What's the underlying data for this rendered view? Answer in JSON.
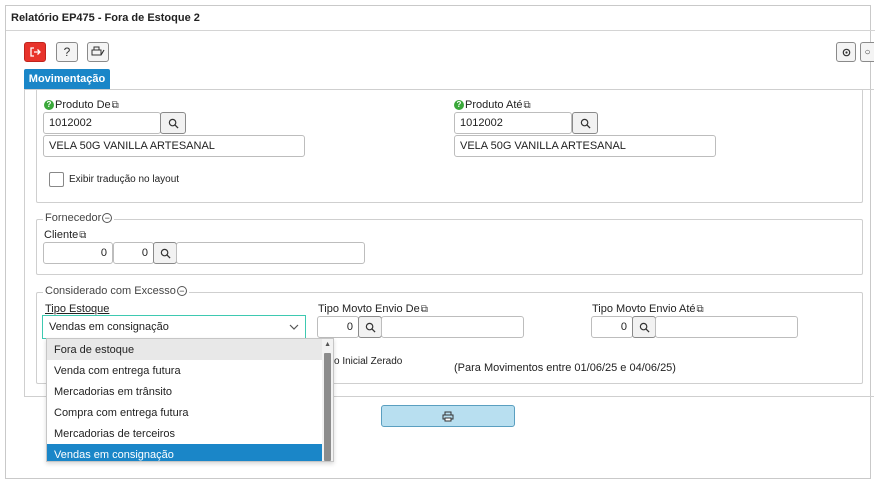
{
  "window": {
    "title": "Relatório EP475 - Fora de Estoque 2"
  },
  "toolbar": {
    "exit_icon": "exit-icon",
    "help_label": "?",
    "print_setup_icon": "print-setup-icon",
    "settings_icon": "gear-icon"
  },
  "tabs": [
    {
      "label": "Movimentação"
    }
  ],
  "produto_de": {
    "label": "Produto De",
    "code": "1012002",
    "description": "VELA 50G VANILLA ARTESANAL"
  },
  "produto_ate": {
    "label": "Produto Até",
    "code": "1012002",
    "description": "VELA 50G VANILLA ARTESANAL"
  },
  "exibir_traducao": {
    "label": "Exibir tradução no layout",
    "checked": false
  },
  "fornecedor": {
    "legend": "Fornecedor",
    "cliente_label": "Cliente",
    "value1": "0",
    "value2": "0",
    "name": ""
  },
  "considerado": {
    "legend": "Considerado com Excesso",
    "tipo_estoque_label": "Tipo Estoque",
    "tipo_estoque_value": "Vendas em consignação",
    "tipo_movto_de_label": "Tipo Movto Envio De",
    "tipo_movto_de_value": "0",
    "tipo_movto_ate_label": "Tipo Movto Envio Até",
    "tipo_movto_ate_value": "0",
    "saldo_label_partial": "o Inicial Zerado",
    "periodo_text": "(Para Movimentos entre 01/06/25 e 04/06/25)"
  },
  "dropdown_options": [
    "Fora de estoque",
    "Venda com entrega futura",
    "Mercadorias em trânsito",
    "Compra com entrega futura",
    "Mercadorias de terceiros",
    "Vendas em consignação"
  ],
  "colors": {
    "accent": "#1a86c8",
    "exit": "#e8332b",
    "focus": "#3ec9b1",
    "print_button": "#b8dff0"
  }
}
